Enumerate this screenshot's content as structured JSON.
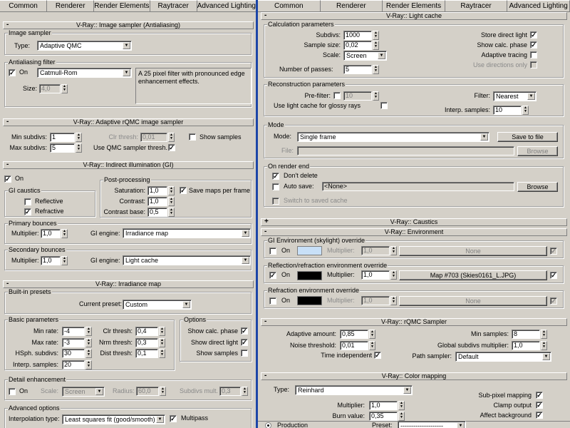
{
  "tabs": [
    "Common",
    "Renderer",
    "Render Elements",
    "Raytracer",
    "Advanced Lighting"
  ],
  "icons": {
    "rollout_open": "minus-sign",
    "rollout_closed": "plus-sign",
    "checkmark": "✓",
    "spinner": "up-down-arrows",
    "dropdown": "down-arrow"
  },
  "left": {
    "image_sampler": {
      "title": "V-Ray:: Image sampler (Antialiasing)",
      "group_image_sampler": "Image sampler",
      "type_label": "Type:",
      "type_value": "Adaptive QMC",
      "group_aa": "Antialiasing filter",
      "on_label": "On",
      "filter_value": "Catmull-Rom",
      "description": "A 25 pixel filter with pronounced edge enhancement effects.",
      "size_label": "Size:",
      "size_value": "4,0"
    },
    "rqmc": {
      "title": "V-Ray:: Adaptive rQMC image sampler",
      "min_label": "Min subdivs:",
      "min_value": "1",
      "max_label": "Max subdivs:",
      "max_value": "5",
      "clr_label": "Clr thresh:",
      "clr_value": "0,01",
      "show_samples": "Show samples",
      "use_qmc": "Use QMC sampler thresh."
    },
    "gi": {
      "title": "V-Ray:: Indirect illumination (GI)",
      "on_label": "On",
      "caustics_group": "GI caustics",
      "reflective": "Reflective",
      "refractive": "Refractive",
      "post_group": "Post-processing",
      "saturation_label": "Saturation:",
      "saturation_value": "1,0",
      "contrast_label": "Contrast:",
      "contrast_value": "1,0",
      "contrast_base_label": "Contrast base:",
      "contrast_base_value": "0,5",
      "save_maps": "Save maps per frame",
      "primary_group": "Primary bounces",
      "primary_mult_label": "Multiplier:",
      "primary_mult_value": "1,0",
      "primary_engine_label": "GI engine:",
      "primary_engine_value": "Irradiance map",
      "secondary_group": "Secondary bounces",
      "secondary_mult_label": "Multiplier:",
      "secondary_mult_value": "1,0",
      "secondary_engine_label": "GI engine:",
      "secondary_engine_value": "Light cache"
    },
    "irr": {
      "title": "V-Ray:: Irradiance map",
      "presets_group": "Built-in presets",
      "preset_label": "Current preset:",
      "preset_value": "Custom",
      "basic_group": "Basic parameters",
      "min_rate_label": "Min rate:",
      "min_rate_value": "-4",
      "max_rate_label": "Max rate:",
      "max_rate_value": "-3",
      "hsph_label": "HSph. subdivs:",
      "hsph_value": "30",
      "interp_label": "Interp. samples:",
      "interp_value": "20",
      "clr_label": "Clr thresh:",
      "clr_value": "0,4",
      "nrm_label": "Nrm thresh:",
      "nrm_value": "0,3",
      "dist_label": "Dist thresh:",
      "dist_value": "0,1",
      "options_group": "Options",
      "show_calc": "Show calc. phase",
      "show_direct": "Show direct light",
      "show_samples": "Show samples",
      "detail_group": "Detail enhancement",
      "detail_on": "On",
      "scale_label": "Scale:",
      "scale_value": "Screen",
      "radius_label": "Radius:",
      "radius_value": "60,0",
      "subdivs_mult_label": "Subdivs mult.",
      "subdivs_mult_value": "0,3",
      "adv_group": "Advanced options",
      "interp_type_label": "Interpolation type:",
      "interp_type_value": "Least squares fit (good/smooth)",
      "multipass": "Multipass"
    }
  },
  "right": {
    "lc": {
      "title": "V-Ray:: Light cache",
      "calc_group": "Calculation parameters",
      "subdivs_label": "Subdivs:",
      "subdivs_value": "1000",
      "sample_size_label": "Sample size:",
      "sample_size_value": "0,02",
      "scale_label": "Scale:",
      "scale_value": "Screen",
      "passes_label": "Number of passes:",
      "passes_value": "5",
      "store_direct": "Store direct light",
      "show_calc": "Show calc. phase",
      "adaptive": "Adaptive tracing",
      "use_dirs": "Use directions only",
      "recon_group": "Reconstruction parameters",
      "prefilter_label": "Pre-filter:",
      "prefilter_value": "10",
      "use_glossy": "Use light cache for glossy rays",
      "filter_label": "Filter:",
      "filter_value": "Nearest",
      "interp_label": "Interp. samples:",
      "interp_value": "10",
      "mode_group": "Mode",
      "mode_label": "Mode:",
      "mode_value": "Single frame",
      "save_btn": "Save to file",
      "file_label": "File:",
      "browse": "Browse",
      "ore_group": "On render end",
      "dont_delete": "Don't delete",
      "auto_save": "Auto save:",
      "auto_save_value": "<None>",
      "browse2": "Browse",
      "switch_saved": "Switch to saved cache"
    },
    "caustics": {
      "title": "V-Ray:: Caustics"
    },
    "env": {
      "title": "V-Ray:: Environment",
      "gi_group": "GI Environment (skylight) override",
      "on_label": "On",
      "mult_label": "Multiplier:",
      "gi_mult": "1,0",
      "gi_map": "None",
      "gi_color": "#c8e0f8",
      "refl_group": "Reflection/refraction environment override",
      "refl_mult": "1,0",
      "refl_map": "Map #703 (Skies0161_L.JPG)",
      "refl_color": "#000000",
      "refr_group": "Refraction environment override",
      "refr_mult": "1,0",
      "refr_map": "None",
      "refr_color": "#000000"
    },
    "rqmc": {
      "title": "V-Ray:: rQMC Sampler",
      "adaptive_label": "Adaptive amount:",
      "adaptive_value": "0,85",
      "noise_label": "Noise threshold:",
      "noise_value": "0,01",
      "time_label": "Time independent",
      "min_samples_label": "Min samples:",
      "min_samples_value": "8",
      "global_label": "Global subdivs multiplier:",
      "global_value": "1,0",
      "path_label": "Path sampler:",
      "path_value": "Default"
    },
    "cm": {
      "title": "V-Ray:: Color mapping",
      "type_label": "Type:",
      "type_value": "Reinhard",
      "mult_label": "Multiplier:",
      "mult_value": "1,0",
      "burn_label": "Burn value:",
      "burn_value": "0,35",
      "subpixel": "Sub-pixel mapping",
      "clamp": "Clamp output",
      "affect_bg": "Affect background"
    },
    "bottom": {
      "production": "Production",
      "preset_label": "Preset:",
      "preset_value": "--------------------"
    }
  }
}
